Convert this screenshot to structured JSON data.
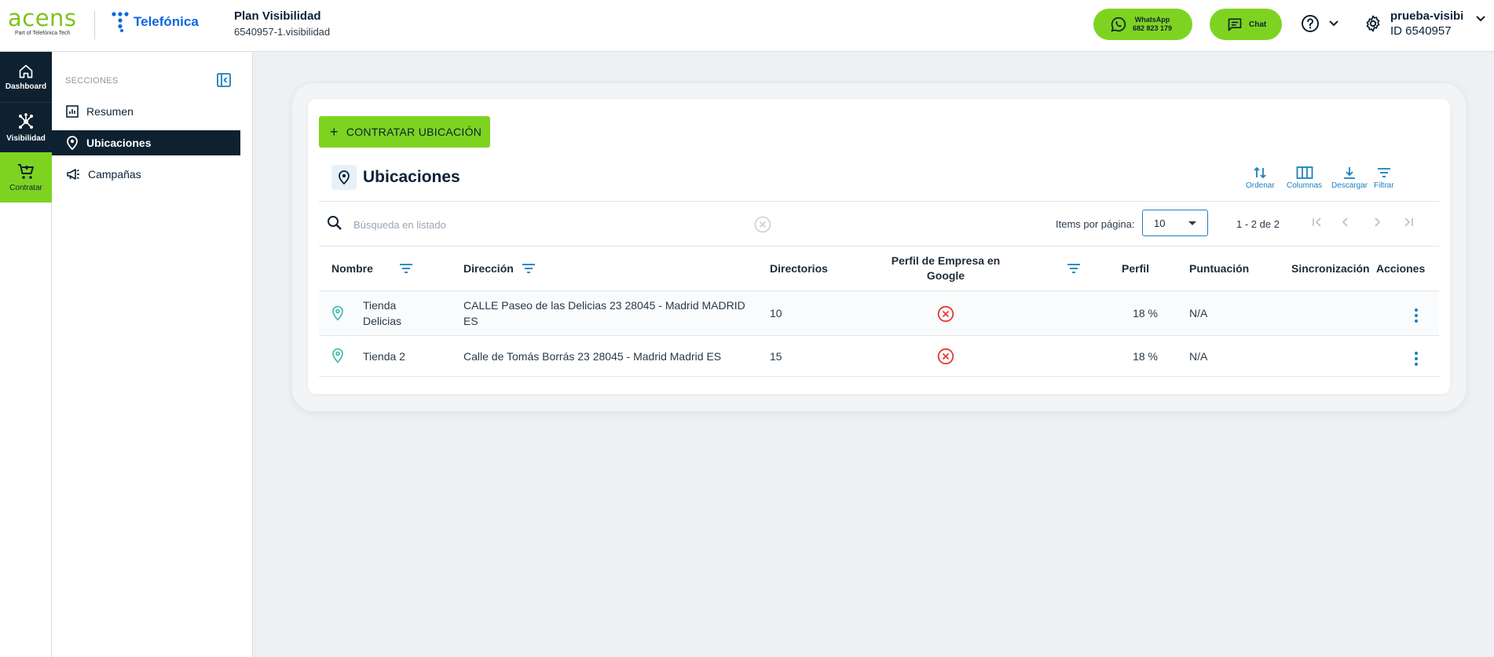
{
  "header": {
    "brand": "acens",
    "brand_sub": "Part of Telefónica Tech",
    "partner": "Telefónica",
    "plan_title": "Plan Visibilidad",
    "plan_id": "6540957-1.visibilidad",
    "whatsapp_label": "WhatsApp",
    "whatsapp_number": "682 823 179",
    "chat_label": "Chat",
    "user_name": "prueba-visibi",
    "user_id": "ID 6540957"
  },
  "rail": {
    "items": [
      {
        "label": "Dashboard",
        "icon": "home-icon"
      },
      {
        "label": "Visibilidad",
        "icon": "network-icon"
      },
      {
        "label": "Contratar",
        "icon": "cart-icon"
      }
    ]
  },
  "sections": {
    "heading": "SECCIONES",
    "items": [
      {
        "label": "Resumen",
        "icon": "chart-icon"
      },
      {
        "label": "Ubicaciones",
        "icon": "location-icon",
        "active": true
      },
      {
        "label": "Campañas",
        "icon": "megaphone-icon"
      }
    ]
  },
  "main": {
    "add_button": "CONTRATAR UBICACIÓN",
    "title": "Ubicaciones",
    "tools": {
      "sort": "Ordenar",
      "columns": "Columnas",
      "download": "Descargar",
      "filter": "Filtrar"
    },
    "search_placeholder": "Búsqueda en listado",
    "items_per_page_label": "Items por página:",
    "items_per_page_value": "10",
    "range": "1 - 2 de 2",
    "columns": {
      "nombre": "Nombre",
      "direccion": "Dirección",
      "directorios": "Directorios",
      "perfil_google": "Perfil de Empresa en Google",
      "perfil": "Perfil",
      "puntuacion": "Puntuación",
      "sincronizacion": "Sincronización",
      "acciones": "Acciones"
    },
    "rows": [
      {
        "nombre": "Tienda Delicias",
        "direccion": "CALLE Paseo de las Delicias 23 28045 - Madrid MADRID ES",
        "directorios": "10",
        "perfil": "18 %",
        "puntuacion": "N/A",
        "sincronizacion": ""
      },
      {
        "nombre": "Tienda 2",
        "direccion": "Calle de Tomás Borrás 23 28045 - Madrid Madrid ES",
        "directorios": "15",
        "perfil": "18 %",
        "puntuacion": "N/A",
        "sincronizacion": ""
      }
    ]
  },
  "colors": {
    "accent_green": "#7ed321",
    "navy": "#0d2130",
    "link_blue": "#1b7fbf",
    "error_red": "#e53935"
  }
}
